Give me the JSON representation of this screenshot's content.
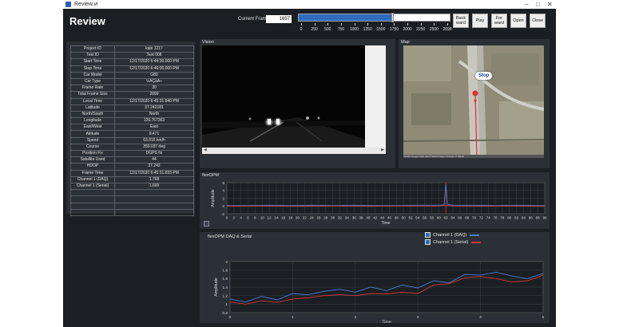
{
  "window": {
    "title": "Review.vi"
  },
  "header": {
    "title": "Review",
    "current_frame_label": "Current Frame",
    "current_frame_value": "1657"
  },
  "slider": {
    "value_fraction": 0.614,
    "tick_labels": [
      "0",
      "250",
      "500",
      "750",
      "1000",
      "1250",
      "1500",
      "1750",
      "2000",
      "2250",
      "2500",
      "2698"
    ]
  },
  "buttons": {
    "backward": "Back ward",
    "play": "Play",
    "forward": "For ward",
    "open": "Open",
    "close": "Close"
  },
  "info_table": [
    [
      "Project ID",
      "kabi 1217"
    ],
    [
      "Test ID",
      "Test 008"
    ],
    [
      "Start Time",
      "12/17/2020 6:44:30.000 PM"
    ],
    [
      "Stop Time",
      "12/17/2020 6:46:00.000 PM"
    ],
    [
      "Car Model",
      "G80"
    ],
    [
      "Car Type",
      "½ÂÇàÂ÷"
    ],
    [
      "Frame Rate",
      "30"
    ],
    [
      "Total Frame Size",
      "2699"
    ],
    [
      "Local Time",
      "12/17/2020 6:45:31.840 PM"
    ],
    [
      "Latitude",
      "37.242181"
    ],
    [
      "North/South",
      "North"
    ],
    [
      "Longitude",
      "126.767363"
    ],
    [
      "East/West",
      "East"
    ],
    [
      "Altitude",
      "8.471"
    ],
    [
      "Speed",
      "63.016 km/h"
    ],
    [
      "Course",
      "359.037 deg"
    ],
    [
      "Position Fix",
      "DGPS fix"
    ],
    [
      "Satellite Used",
      "44"
    ],
    [
      "HDOP",
      "37.242"
    ],
    [
      "Frame Time",
      "12/17/2020 6:45:31.833 PM"
    ],
    [
      "Channel 1 (DAQ)",
      "1.768"
    ],
    [
      "Channel 1 (Serial)",
      "1.699"
    ],
    [
      "",
      ""
    ],
    [
      "",
      ""
    ],
    [
      "",
      ""
    ],
    [
      "",
      ""
    ]
  ],
  "vision": {
    "title": "Vision"
  },
  "map": {
    "title": "Map",
    "marker_label": "Stop",
    "footer_text": "©2020 Google   Map data ©2020   Image courtesy of Maxar"
  },
  "colors": {
    "series_daq": "#4a7fd0",
    "series_serial": "#d03b3b",
    "accent": "#2f6cc0"
  },
  "chart_data": [
    {
      "type": "line",
      "title": "flexOPM",
      "xlabel": "Time",
      "ylabel": "Amplitude",
      "xlim": [
        0,
        90
      ],
      "ylim": [
        -2,
        6
      ],
      "x_ticks": [
        0,
        2,
        4,
        6,
        8,
        10,
        12,
        14,
        16,
        18,
        20,
        22,
        24,
        26,
        28,
        30,
        32,
        34,
        36,
        38,
        40,
        42,
        44,
        46,
        48,
        50,
        52,
        54,
        56,
        58,
        60,
        62,
        64,
        66,
        68,
        70,
        72,
        74,
        76,
        78,
        80,
        82,
        84,
        86,
        88,
        90
      ],
      "y_ticks": [
        -2,
        0,
        2,
        4,
        6
      ],
      "cursor_x": 62,
      "series": [
        {
          "name": "Channel 1 (DAQ)",
          "x": [
            0,
            6,
            12,
            18,
            24,
            30,
            36,
            42,
            48,
            54,
            60,
            61.5,
            62,
            62.5,
            64,
            70,
            76,
            82,
            88,
            90
          ],
          "values": [
            0.1,
            0.1,
            0.2,
            0.1,
            0.2,
            0.1,
            0.2,
            0.1,
            0.1,
            0.2,
            0.2,
            0.3,
            5.6,
            0.4,
            0.2,
            0.2,
            0.1,
            0.2,
            0.1,
            0.1
          ]
        },
        {
          "name": "Channel 1 (Serial)",
          "x": [
            0,
            10,
            20,
            30,
            40,
            50,
            60,
            62,
            64,
            70,
            80,
            90
          ],
          "values": [
            -0.1,
            0.0,
            -0.1,
            0.0,
            -0.1,
            0.0,
            0.0,
            0.2,
            0.0,
            -0.1,
            0.0,
            -0.1
          ]
        }
      ]
    },
    {
      "type": "line",
      "title": "flexOPM DAQ & Serial",
      "xlabel": "Time",
      "ylabel": "Amplitude",
      "xlim": [
        0,
        5
      ],
      "ylim": [
        0.8,
        2
      ],
      "x_ticks": [
        0,
        1,
        2,
        3,
        4,
        5
      ],
      "y_ticks": [
        0.8,
        1,
        1.2,
        1.4,
        1.6,
        1.8,
        2
      ],
      "series": [
        {
          "name": "Channel 1 (DAQ)",
          "x": [
            0,
            0.25,
            0.5,
            0.75,
            1,
            1.25,
            1.5,
            1.75,
            2,
            2.25,
            2.5,
            2.75,
            3,
            3.25,
            3.5,
            3.75,
            4,
            4.25,
            4.5,
            4.75,
            5
          ],
          "values": [
            1.12,
            1.05,
            1.18,
            1.1,
            1.25,
            1.22,
            1.3,
            1.35,
            1.28,
            1.4,
            1.32,
            1.45,
            1.38,
            1.55,
            1.5,
            1.7,
            1.68,
            1.75,
            1.66,
            1.6,
            1.72
          ]
        },
        {
          "name": "Channel 1 (Serial)",
          "x": [
            0,
            0.25,
            0.5,
            0.75,
            1,
            1.25,
            1.5,
            1.75,
            2,
            2.25,
            2.5,
            2.75,
            3,
            3.25,
            3.5,
            3.75,
            4,
            4.25,
            4.5,
            4.75,
            5
          ],
          "values": [
            1.05,
            1.0,
            1.08,
            1.04,
            1.12,
            1.15,
            1.2,
            1.22,
            1.2,
            1.25,
            1.24,
            1.28,
            1.25,
            1.45,
            1.48,
            1.62,
            1.65,
            1.6,
            1.52,
            1.55,
            1.68
          ]
        }
      ]
    }
  ]
}
